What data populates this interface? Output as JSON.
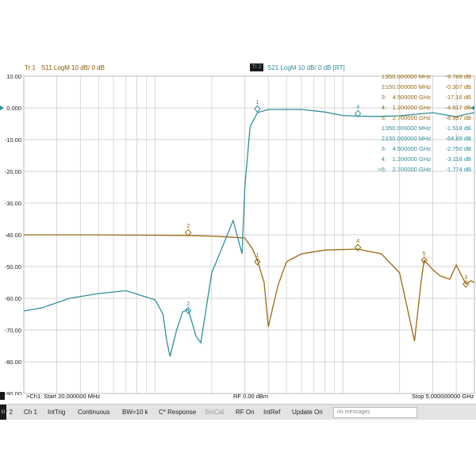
{
  "header": {
    "trace1_name": "Tr 1",
    "trace1_meas": "S11 LogM 10 dB/ 0 dB",
    "trace2_name": "Tr 2",
    "trace2_meas": "S21 LogM 10 dB/ 0 dB [RT]"
  },
  "axis": {
    "start_label": ">Ch1: Start 20.000000 MHz",
    "center_label": "RF 0.00 dBm",
    "stop_label": "Stop 5.000000000 GHz"
  },
  "markers": {
    "s11": [
      {
        "id": "1:",
        "freq": "350.000000 MHz",
        "value": "-9.788 dB"
      },
      {
        "id": "2:",
        "freq": "150.000000 MHz",
        "value": "-0.307 dB"
      },
      {
        "id": "3:",
        "freq": "4.500000 GHz",
        "value": "-17.16 dB"
      },
      {
        "id": "4:",
        "freq": "1.200000 GHz",
        "value": "-4.817 dB"
      },
      {
        "id": "5:",
        "freq": "2.700000 GHz",
        "value": "-8.997 dB"
      }
    ],
    "s21": [
      {
        "id": "1:",
        "freq": "350.000000 MHz",
        "value": "-1.518 dB"
      },
      {
        "id": "2:",
        "freq": "150.000000 MHz",
        "value": "-64.89 dB"
      },
      {
        "id": "3:",
        "freq": "4.500000 GHz",
        "value": "-2.750 dB"
      },
      {
        "id": "4:",
        "freq": "1.200000 GHz",
        "value": "-3.118 dB"
      },
      {
        "id": ">5:",
        "freq": "2.700000 GHz",
        "value": "-1.774 dB"
      }
    ]
  },
  "status": {
    "indicator": "0",
    "items": [
      "Tr 2",
      "Ch 1",
      "IntTrig",
      "Continuous",
      "BW=10 k",
      "C* Response",
      "SrcCal",
      "RF On",
      "IntRef",
      "Update On"
    ],
    "messages": "no messages"
  },
  "colors": {
    "s11": "#9a6a12",
    "s21": "#2f8f9c",
    "grid": "#c9c9c9",
    "statusbar": "#e3e3e3"
  },
  "chart_data": {
    "type": "line",
    "title": "",
    "xlabel": "",
    "ylabel": "",
    "x_unit": "MHz",
    "xlim": [
      20,
      5000
    ],
    "ylim": [
      -90,
      10
    ],
    "x_scale": "log",
    "y_ticks": [
      "10.00",
      "0.000",
      "-10.00",
      "-20.00",
      "-30.00",
      "-40.00",
      "-50.00",
      "-60.00",
      "-70.00",
      "-80.00",
      "-90.00"
    ],
    "series": [
      {
        "name": "S11",
        "x": [
          20,
          40,
          80,
          150,
          200,
          250,
          300,
          330,
          350,
          380,
          400,
          450,
          500,
          600,
          800,
          1200,
          1600,
          2000,
          2400,
          2600,
          2700,
          2850,
          3000,
          3300,
          3700,
          4000,
          4500,
          4800,
          5000
        ],
        "y": [
          -40.0,
          -40.0,
          -40.1,
          -40.2,
          -40.4,
          -40.7,
          -41.0,
          -44.5,
          -48.0,
          -55.0,
          -69.0,
          -56.0,
          -48.5,
          -46.0,
          -44.8,
          -44.5,
          -46.0,
          -52.0,
          -73.5,
          -55.0,
          -48.0,
          -49.5,
          -51.0,
          -53.0,
          -54.0,
          -49.5,
          -55.5,
          -54.5,
          -55.0
        ]
      },
      {
        "name": "S21",
        "x": [
          20,
          25,
          35,
          50,
          70,
          100,
          110,
          115,
          120,
          130,
          140,
          150,
          165,
          175,
          200,
          260,
          290,
          300,
          320,
          350,
          400,
          600,
          800,
          1000,
          1200,
          1500,
          2000,
          3000,
          4000,
          4500,
          5000
        ],
        "y": [
          -64.0,
          -63.0,
          -60.0,
          -58.5,
          -57.6,
          -60.5,
          -65.0,
          -73.0,
          -78.3,
          -70.0,
          -64.3,
          -63.5,
          -72.0,
          -74.0,
          -52.0,
          -35.5,
          -46.0,
          -25.0,
          -6.0,
          -1.5,
          -0.5,
          -0.5,
          -1.3,
          -2.4,
          -2.6,
          -2.7,
          -2.5,
          -1.5,
          -2.8,
          -2.0,
          -1.5
        ]
      }
    ],
    "markers": [
      {
        "series": "S11",
        "label": "1",
        "x": 350,
        "y": -48.5
      },
      {
        "series": "S11",
        "label": "2",
        "x": 150,
        "y": -39.3
      },
      {
        "series": "S11",
        "label": "3",
        "x": 4500,
        "y": -55.5
      },
      {
        "series": "S11",
        "label": "4",
        "x": 1200,
        "y": -44.0
      },
      {
        "series": "S11",
        "label": "5",
        "x": 2700,
        "y": -48.0
      },
      {
        "series": "S21",
        "label": "1",
        "x": 350,
        "y": -0.3
      },
      {
        "series": "S21",
        "label": "2",
        "x": 150,
        "y": -63.8
      },
      {
        "series": "S21",
        "label": "4",
        "x": 1200,
        "y": -1.8
      }
    ]
  }
}
